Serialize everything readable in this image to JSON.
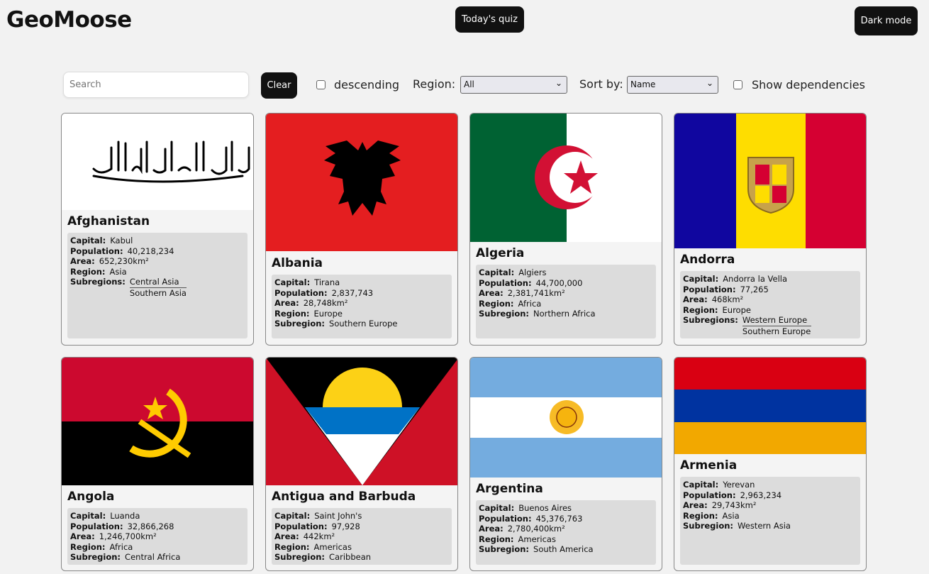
{
  "header": {
    "brand": "GeoMoose",
    "quiz_label": "Today's quiz",
    "dark_label": "Dark mode"
  },
  "toolbar": {
    "search_placeholder": "Search",
    "clear_label": "Clear",
    "descending_label": "descending",
    "region_label": "Region:",
    "region_value": "All",
    "sort_label": "Sort by:",
    "sort_value": "Name",
    "dependencies_label": "Show dependencies"
  },
  "labels": {
    "capital": "Capital:",
    "population": "Population:",
    "area": "Area:",
    "region": "Region:",
    "subregion": "Subregion:",
    "subregions": "Subregions:"
  },
  "countries": [
    {
      "name": "Afghanistan",
      "capital": "Kabul",
      "population": "40,218,234",
      "area": "652,230km²",
      "region": "Asia",
      "subregions": [
        "Central Asia",
        "Southern Asia"
      ]
    },
    {
      "name": "Albania",
      "capital": "Tirana",
      "population": "2,837,743",
      "area": "28,748km²",
      "region": "Europe",
      "subregion": "Southern Europe"
    },
    {
      "name": "Algeria",
      "capital": "Algiers",
      "population": "44,700,000",
      "area": "2,381,741km²",
      "region": "Africa",
      "subregion": "Northern Africa"
    },
    {
      "name": "Andorra",
      "capital": "Andorra la Vella",
      "population": "77,265",
      "area": "468km²",
      "region": "Europe",
      "subregions": [
        "Western Europe",
        "Southern Europe"
      ]
    },
    {
      "name": "Angola",
      "capital": "Luanda",
      "population": "32,866,268",
      "area": "1,246,700km²",
      "region": "Africa",
      "subregion": "Central Africa"
    },
    {
      "name": "Antigua and Barbuda",
      "capital": "Saint John's",
      "population": "97,928",
      "area": "442km²",
      "region": "Americas",
      "subregion": "Caribbean"
    },
    {
      "name": "Argentina",
      "capital": "Buenos Aires",
      "population": "45,376,763",
      "area": "2,780,400km²",
      "region": "Americas",
      "subregion": "South America"
    },
    {
      "name": "Armenia",
      "capital": "Yerevan",
      "population": "2,963,234",
      "area": "29,743km²",
      "region": "Asia",
      "subregion": "Western Asia"
    }
  ]
}
